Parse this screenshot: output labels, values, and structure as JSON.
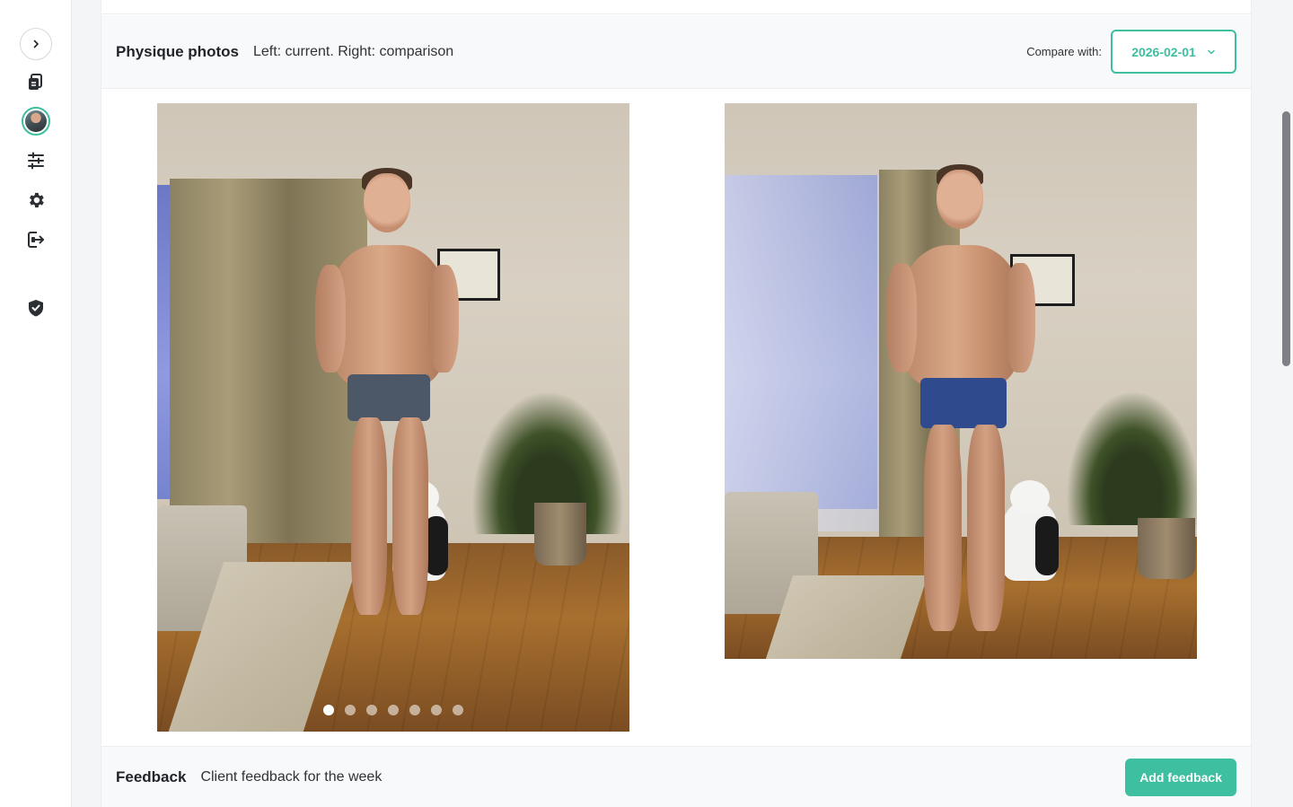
{
  "sidebar": {
    "items": [
      {
        "name": "expand-sidebar",
        "icon": "chevron-right-icon"
      },
      {
        "name": "documents",
        "icon": "documents-icon"
      },
      {
        "name": "client-avatar",
        "icon": "avatar-icon"
      },
      {
        "name": "adjustments",
        "icon": "sliders-icon"
      },
      {
        "name": "settings",
        "icon": "gear-icon"
      },
      {
        "name": "logout",
        "icon": "logout-icon"
      },
      {
        "name": "security",
        "icon": "shield-check-icon"
      }
    ]
  },
  "physique": {
    "title": "Physique photos",
    "subtitle": "Left: current. Right: comparison",
    "compare_label": "Compare with:",
    "compare_value": "2026-02-01",
    "carousel": {
      "count": 7,
      "active_index": 0
    }
  },
  "feedback": {
    "title": "Feedback",
    "subtitle": "Client feedback for the week",
    "add_button": "Add feedback"
  },
  "colors": {
    "accent": "#3dbfa0",
    "header_bg": "#f8f9fa"
  }
}
